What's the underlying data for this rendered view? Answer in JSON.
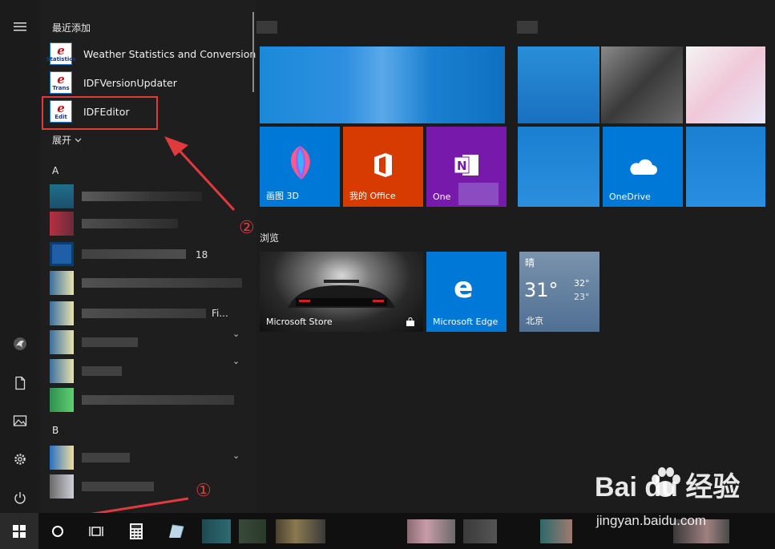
{
  "start_menu": {
    "recently_added_title": "最近添加",
    "recent_apps": [
      {
        "label": "Weather Statistics and Conversions",
        "icon": "weather-stats-app-icon",
        "sub": "Statistics"
      },
      {
        "label": "IDFVersionUpdater",
        "icon": "idf-version-updater-icon",
        "sub": "Trans"
      },
      {
        "label": "IDFEditor",
        "icon": "idf-editor-icon",
        "sub": "Edit"
      }
    ],
    "expand_label": "展开",
    "letter_a": "A",
    "letter_b": "B",
    "fragment_18": "18",
    "fragment_fi": "Fi...",
    "tile_groups": {
      "browse_label": "浏览"
    },
    "tiles": {
      "paint3d": "画图 3D",
      "office": "我的 Office",
      "onenote": "One",
      "onedrive": "OneDrive",
      "store": "Microsoft Store",
      "edge": "Microsoft Edge",
      "weather": {
        "condition": "晴",
        "temp": "31°",
        "high": "32°",
        "low": "23°",
        "city": "北京"
      }
    }
  },
  "annotations": {
    "step1": "①",
    "step2": "②"
  },
  "watermark": {
    "logo": "Bai  du 经验",
    "url": "jingyan.baidu.com"
  },
  "colors": {
    "accent": "#0078d7",
    "office": "#d83b01",
    "onenote": "#7719aa",
    "highlight": "#e0393e"
  },
  "icons": {
    "rail": [
      "hamburger-menu-icon",
      "user-avatar-icon",
      "documents-icon",
      "pictures-icon",
      "settings-gear-icon",
      "power-icon"
    ],
    "taskbar": [
      "windows-start-icon",
      "cortana-search-icon",
      "task-view-icon",
      "calculator-icon"
    ]
  }
}
